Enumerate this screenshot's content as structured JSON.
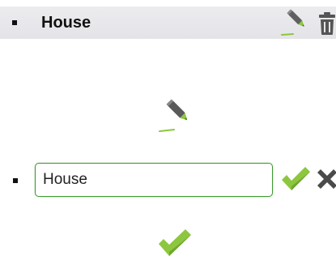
{
  "list_item": {
    "label": "House"
  },
  "edit_row": {
    "input_value": "House"
  },
  "icons": {
    "edit": "pencil-icon",
    "delete": "trash-icon",
    "confirm": "check-icon",
    "cancel": "close-icon"
  },
  "colors": {
    "accent_green": "#8dc63f",
    "input_border": "#3f9a32",
    "icon_dark": "#555555",
    "row_background": "#e6e6ea"
  }
}
